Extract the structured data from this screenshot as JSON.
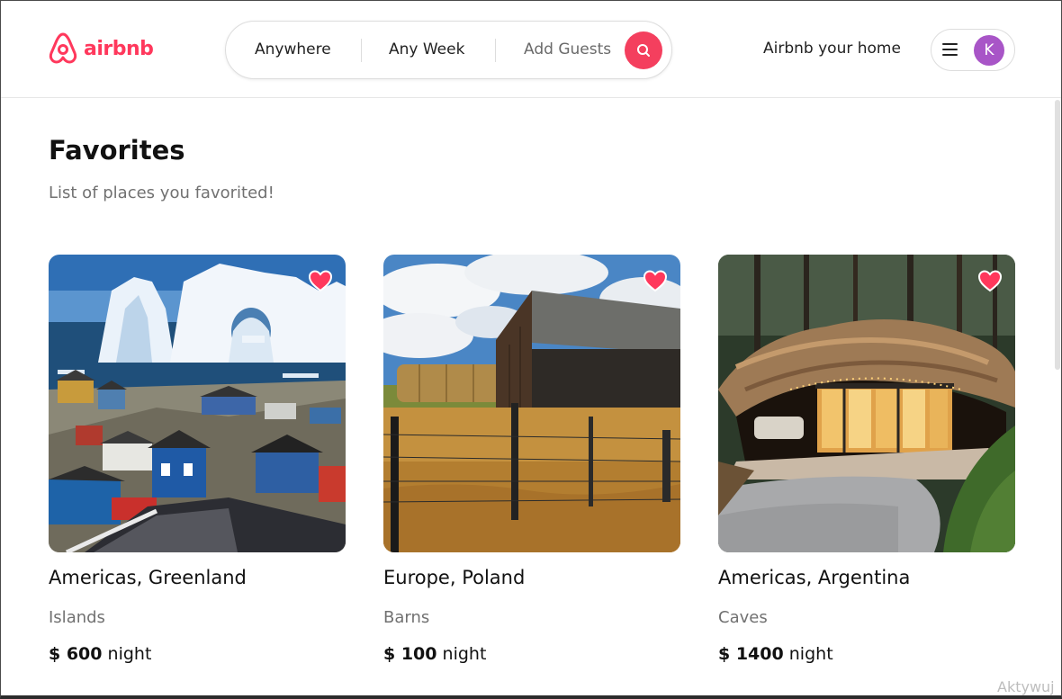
{
  "header": {
    "logo_text": "airbnb",
    "search": {
      "location": "Anywhere",
      "dates": "Any Week",
      "guests": "Add Guests"
    },
    "host_link": "Airbnb your home",
    "avatar_initial": "K"
  },
  "main": {
    "title": "Favorites",
    "subtitle": "List of places you favorited!",
    "listings": [
      {
        "location": "Americas, Greenland",
        "category": "Islands",
        "price": "$ 600",
        "unit": "night",
        "favorited": true,
        "image_icon": "greenland-icebergs-photo"
      },
      {
        "location": "Europe, Poland",
        "category": "Barns",
        "price": "$ 100",
        "unit": "night",
        "favorited": true,
        "image_icon": "wooden-barn-field-photo"
      },
      {
        "location": "Americas, Argentina",
        "category": "Caves",
        "price": "$ 1400",
        "unit": "night",
        "favorited": true,
        "image_icon": "cave-house-forest-photo"
      }
    ]
  },
  "watermark": "Aktywuj",
  "colors": {
    "brand": "#ff385c",
    "search_button": "#f43f5e",
    "avatar": "#a855c7",
    "heart": "#ff385c"
  }
}
